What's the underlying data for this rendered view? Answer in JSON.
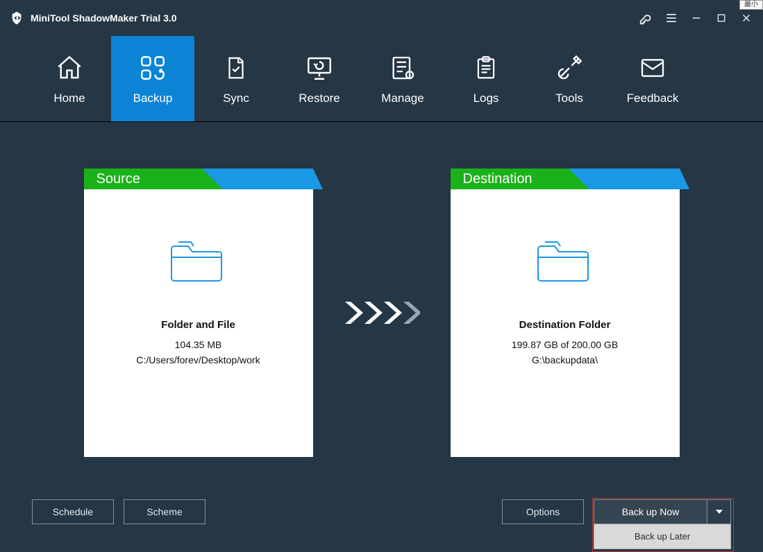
{
  "app": {
    "title": "MiniTool ShadowMaker Trial 3.0",
    "mini_badge": "最小"
  },
  "nav": {
    "home": "Home",
    "backup": "Backup",
    "sync": "Sync",
    "restore": "Restore",
    "manage": "Manage",
    "logs": "Logs",
    "tools": "Tools",
    "feedback": "Feedback"
  },
  "source": {
    "tab": "Source",
    "title": "Folder and File",
    "size": "104.35 MB",
    "path": "C:/Users/forev/Desktop/work"
  },
  "destination": {
    "tab": "Destination",
    "title": "Destination Folder",
    "size": "199.87 GB of 200.00 GB",
    "path": "G:\\backupdata\\"
  },
  "buttons": {
    "schedule": "Schedule",
    "scheme": "Scheme",
    "options": "Options",
    "backup_now": "Back up Now",
    "backup_later": "Back up Later"
  }
}
